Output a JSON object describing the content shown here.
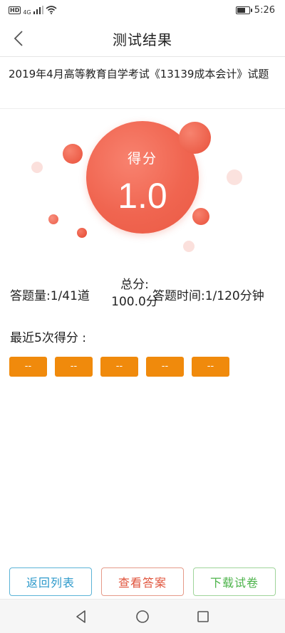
{
  "status_bar": {
    "left_badge": "HD",
    "network": "4G",
    "time": "5:26",
    "icons": [
      "hd-icon",
      "signal-icon",
      "wifi-icon",
      "battery-icon"
    ]
  },
  "header": {
    "title": "测试结果",
    "back_icon": "chevron-left-icon"
  },
  "exam": {
    "title": "2019年4月高等教育自学考试《13139成本会计》试题"
  },
  "score": {
    "label": "得分",
    "value": "1.0"
  },
  "stats": {
    "answered": "答题量:1/41道",
    "total_label": "总分:",
    "total_value": "100.0分",
    "time": "答题时间:1/120分钟"
  },
  "recent": {
    "title": "最近5次得分 :",
    "scores": [
      "--",
      "--",
      "--",
      "--",
      "--"
    ]
  },
  "buttons": {
    "back_list": "返回列表",
    "view_answers": "查看答案",
    "download": "下载试卷"
  },
  "nav": {
    "icons": [
      "back-triangle-icon",
      "home-circle-icon",
      "recents-square-icon"
    ]
  },
  "colors": {
    "score_circle": "#f06550",
    "recent_badge": "#f08a0c",
    "btn_list": "#2e9acb",
    "btn_answer": "#e0533b",
    "btn_download": "#4cb34a"
  }
}
